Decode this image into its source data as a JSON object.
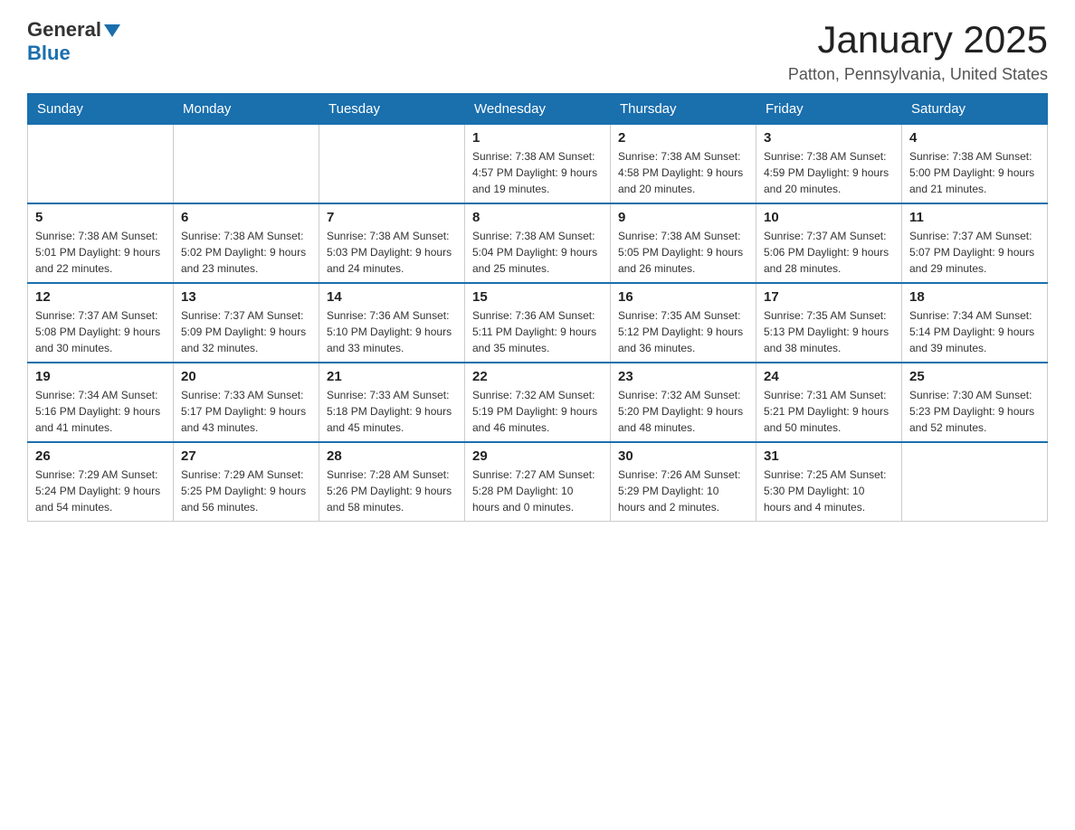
{
  "header": {
    "logo_general": "General",
    "logo_blue": "Blue",
    "title": "January 2025",
    "subtitle": "Patton, Pennsylvania, United States"
  },
  "days_of_week": [
    "Sunday",
    "Monday",
    "Tuesday",
    "Wednesday",
    "Thursday",
    "Friday",
    "Saturday"
  ],
  "weeks": [
    [
      {
        "day": "",
        "info": ""
      },
      {
        "day": "",
        "info": ""
      },
      {
        "day": "",
        "info": ""
      },
      {
        "day": "1",
        "info": "Sunrise: 7:38 AM\nSunset: 4:57 PM\nDaylight: 9 hours\nand 19 minutes."
      },
      {
        "day": "2",
        "info": "Sunrise: 7:38 AM\nSunset: 4:58 PM\nDaylight: 9 hours\nand 20 minutes."
      },
      {
        "day": "3",
        "info": "Sunrise: 7:38 AM\nSunset: 4:59 PM\nDaylight: 9 hours\nand 20 minutes."
      },
      {
        "day": "4",
        "info": "Sunrise: 7:38 AM\nSunset: 5:00 PM\nDaylight: 9 hours\nand 21 minutes."
      }
    ],
    [
      {
        "day": "5",
        "info": "Sunrise: 7:38 AM\nSunset: 5:01 PM\nDaylight: 9 hours\nand 22 minutes."
      },
      {
        "day": "6",
        "info": "Sunrise: 7:38 AM\nSunset: 5:02 PM\nDaylight: 9 hours\nand 23 minutes."
      },
      {
        "day": "7",
        "info": "Sunrise: 7:38 AM\nSunset: 5:03 PM\nDaylight: 9 hours\nand 24 minutes."
      },
      {
        "day": "8",
        "info": "Sunrise: 7:38 AM\nSunset: 5:04 PM\nDaylight: 9 hours\nand 25 minutes."
      },
      {
        "day": "9",
        "info": "Sunrise: 7:38 AM\nSunset: 5:05 PM\nDaylight: 9 hours\nand 26 minutes."
      },
      {
        "day": "10",
        "info": "Sunrise: 7:37 AM\nSunset: 5:06 PM\nDaylight: 9 hours\nand 28 minutes."
      },
      {
        "day": "11",
        "info": "Sunrise: 7:37 AM\nSunset: 5:07 PM\nDaylight: 9 hours\nand 29 minutes."
      }
    ],
    [
      {
        "day": "12",
        "info": "Sunrise: 7:37 AM\nSunset: 5:08 PM\nDaylight: 9 hours\nand 30 minutes."
      },
      {
        "day": "13",
        "info": "Sunrise: 7:37 AM\nSunset: 5:09 PM\nDaylight: 9 hours\nand 32 minutes."
      },
      {
        "day": "14",
        "info": "Sunrise: 7:36 AM\nSunset: 5:10 PM\nDaylight: 9 hours\nand 33 minutes."
      },
      {
        "day": "15",
        "info": "Sunrise: 7:36 AM\nSunset: 5:11 PM\nDaylight: 9 hours\nand 35 minutes."
      },
      {
        "day": "16",
        "info": "Sunrise: 7:35 AM\nSunset: 5:12 PM\nDaylight: 9 hours\nand 36 minutes."
      },
      {
        "day": "17",
        "info": "Sunrise: 7:35 AM\nSunset: 5:13 PM\nDaylight: 9 hours\nand 38 minutes."
      },
      {
        "day": "18",
        "info": "Sunrise: 7:34 AM\nSunset: 5:14 PM\nDaylight: 9 hours\nand 39 minutes."
      }
    ],
    [
      {
        "day": "19",
        "info": "Sunrise: 7:34 AM\nSunset: 5:16 PM\nDaylight: 9 hours\nand 41 minutes."
      },
      {
        "day": "20",
        "info": "Sunrise: 7:33 AM\nSunset: 5:17 PM\nDaylight: 9 hours\nand 43 minutes."
      },
      {
        "day": "21",
        "info": "Sunrise: 7:33 AM\nSunset: 5:18 PM\nDaylight: 9 hours\nand 45 minutes."
      },
      {
        "day": "22",
        "info": "Sunrise: 7:32 AM\nSunset: 5:19 PM\nDaylight: 9 hours\nand 46 minutes."
      },
      {
        "day": "23",
        "info": "Sunrise: 7:32 AM\nSunset: 5:20 PM\nDaylight: 9 hours\nand 48 minutes."
      },
      {
        "day": "24",
        "info": "Sunrise: 7:31 AM\nSunset: 5:21 PM\nDaylight: 9 hours\nand 50 minutes."
      },
      {
        "day": "25",
        "info": "Sunrise: 7:30 AM\nSunset: 5:23 PM\nDaylight: 9 hours\nand 52 minutes."
      }
    ],
    [
      {
        "day": "26",
        "info": "Sunrise: 7:29 AM\nSunset: 5:24 PM\nDaylight: 9 hours\nand 54 minutes."
      },
      {
        "day": "27",
        "info": "Sunrise: 7:29 AM\nSunset: 5:25 PM\nDaylight: 9 hours\nand 56 minutes."
      },
      {
        "day": "28",
        "info": "Sunrise: 7:28 AM\nSunset: 5:26 PM\nDaylight: 9 hours\nand 58 minutes."
      },
      {
        "day": "29",
        "info": "Sunrise: 7:27 AM\nSunset: 5:28 PM\nDaylight: 10 hours\nand 0 minutes."
      },
      {
        "day": "30",
        "info": "Sunrise: 7:26 AM\nSunset: 5:29 PM\nDaylight: 10 hours\nand 2 minutes."
      },
      {
        "day": "31",
        "info": "Sunrise: 7:25 AM\nSunset: 5:30 PM\nDaylight: 10 hours\nand 4 minutes."
      },
      {
        "day": "",
        "info": ""
      }
    ]
  ]
}
